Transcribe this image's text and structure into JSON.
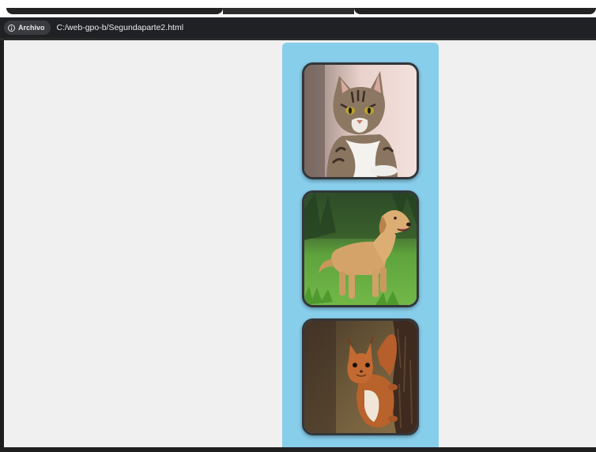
{
  "browser": {
    "origin_chip_label": "Archivo",
    "origin_chip_icon": "info-icon",
    "url": "C:/web-gpo-b/Segundaparte2.html"
  },
  "page": {
    "background_color": "#f0f0f0",
    "panel_color": "#87ceeb",
    "images": [
      {
        "subject": "tabby cat"
      },
      {
        "subject": "golden retriever dog on grass"
      },
      {
        "subject": "red squirrel on tree trunk"
      }
    ]
  }
}
